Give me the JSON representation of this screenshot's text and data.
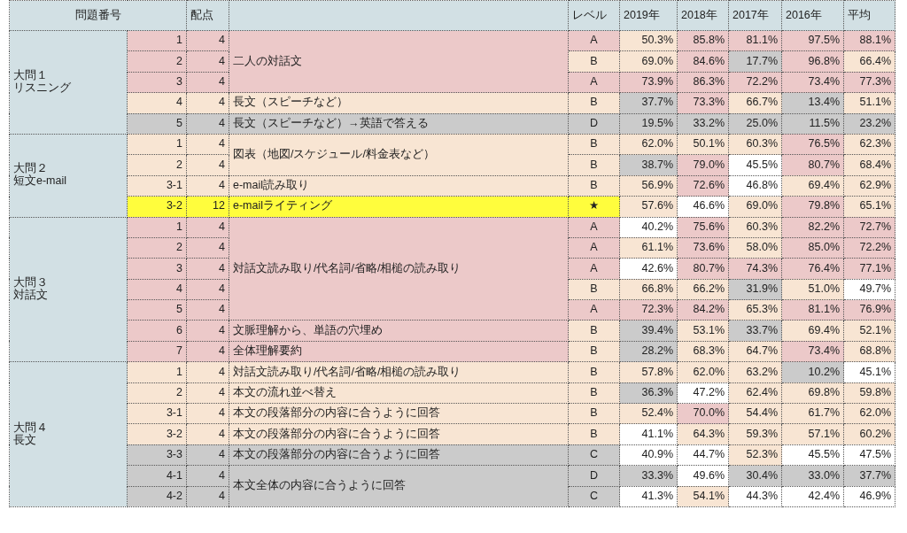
{
  "header": {
    "question_number": "問題番号",
    "points": "配点",
    "level": "レベル",
    "years": [
      "2019年",
      "2018年",
      "2017年",
      "2016年"
    ],
    "average": "平均"
  },
  "sections": [
    {
      "title": "大問１",
      "subtitle": "リスニング",
      "groups": [
        {
          "description": "二人の対話文",
          "color": "#ecc9c9",
          "rows": [
            {
              "no": "1",
              "points": "4",
              "level": {
                "text": "A",
                "color": "#ecc9c9"
              },
              "values": [
                {
                  "text": "50.3%",
                  "color": "#f8e5d3"
                },
                {
                  "text": "85.8%",
                  "color": "#ecc9c9"
                },
                {
                  "text": "81.1%",
                  "color": "#ecc9c9"
                },
                {
                  "text": "97.5%",
                  "color": "#ecc9c9"
                },
                {
                  "text": "88.1%",
                  "color": "#ecc9c9"
                }
              ]
            },
            {
              "no": "2",
              "points": "4",
              "level": {
                "text": "B",
                "color": "#f8e5d3"
              },
              "values": [
                {
                  "text": "69.0%",
                  "color": "#f8e5d3"
                },
                {
                  "text": "84.6%",
                  "color": "#ecc9c9"
                },
                {
                  "text": "17.7%",
                  "color": "#cbcbcb"
                },
                {
                  "text": "96.8%",
                  "color": "#ecc9c9"
                },
                {
                  "text": "66.4%",
                  "color": "#f8e5d3"
                }
              ]
            },
            {
              "no": "3",
              "points": "4",
              "level": {
                "text": "A",
                "color": "#ecc9c9"
              },
              "values": [
                {
                  "text": "73.9%",
                  "color": "#ecc9c9"
                },
                {
                  "text": "86.3%",
                  "color": "#ecc9c9"
                },
                {
                  "text": "72.2%",
                  "color": "#ecc9c9"
                },
                {
                  "text": "73.4%",
                  "color": "#ecc9c9"
                },
                {
                  "text": "77.3%",
                  "color": "#ecc9c9"
                }
              ]
            }
          ]
        },
        {
          "description": "長文（スピーチなど）",
          "color": "#f8e5d3",
          "rows": [
            {
              "no": "4",
              "points": "4",
              "level": {
                "text": "B",
                "color": "#f8e5d3"
              },
              "values": [
                {
                  "text": "37.7%",
                  "color": "#cbcbcb"
                },
                {
                  "text": "73.3%",
                  "color": "#ecc9c9"
                },
                {
                  "text": "66.7%",
                  "color": "#f8e5d3"
                },
                {
                  "text": "13.4%",
                  "color": "#cbcbcb"
                },
                {
                  "text": "51.1%",
                  "color": "#f8e5d3"
                }
              ]
            }
          ]
        },
        {
          "description": "長文（スピーチなど）→英語で答える",
          "color": "#cbcbcb",
          "rows": [
            {
              "no": "5",
              "points": "4",
              "level": {
                "text": "D",
                "color": "#cbcbcb"
              },
              "values": [
                {
                  "text": "19.5%",
                  "color": "#cbcbcb"
                },
                {
                  "text": "33.2%",
                  "color": "#cbcbcb"
                },
                {
                  "text": "25.0%",
                  "color": "#cbcbcb"
                },
                {
                  "text": "11.5%",
                  "color": "#cbcbcb"
                },
                {
                  "text": "23.2%",
                  "color": "#cbcbcb"
                }
              ]
            }
          ]
        }
      ]
    },
    {
      "title": "大問２",
      "subtitle": "短文e-mail",
      "groups": [
        {
          "description": "図表（地図/スケジュール/料金表など）",
          "color": "#f8e5d3",
          "rows": [
            {
              "no": "1",
              "points": "4",
              "level": {
                "text": "B",
                "color": "#f8e5d3"
              },
              "values": [
                {
                  "text": "62.0%",
                  "color": "#f8e5d3"
                },
                {
                  "text": "50.1%",
                  "color": "#f8e5d3"
                },
                {
                  "text": "60.3%",
                  "color": "#f8e5d3"
                },
                {
                  "text": "76.5%",
                  "color": "#ecc9c9"
                },
                {
                  "text": "62.3%",
                  "color": "#f8e5d3"
                }
              ]
            },
            {
              "no": "2",
              "points": "4",
              "level": {
                "text": "B",
                "color": "#f8e5d3"
              },
              "values": [
                {
                  "text": "38.7%",
                  "color": "#cbcbcb"
                },
                {
                  "text": "79.0%",
                  "color": "#ecc9c9"
                },
                {
                  "text": "45.5%",
                  "color": "#ffffff"
                },
                {
                  "text": "80.7%",
                  "color": "#ecc9c9"
                },
                {
                  "text": "68.4%",
                  "color": "#f8e5d3"
                }
              ]
            }
          ]
        },
        {
          "description": "e-mail読み取り",
          "color": "#f8e5d3",
          "rows": [
            {
              "no": "3-1",
              "points": "4",
              "level": {
                "text": "B",
                "color": "#f8e5d3"
              },
              "values": [
                {
                  "text": "56.9%",
                  "color": "#f8e5d3"
                },
                {
                  "text": "72.6%",
                  "color": "#ecc9c9"
                },
                {
                  "text": "46.8%",
                  "color": "#ffffff"
                },
                {
                  "text": "69.4%",
                  "color": "#f8e5d3"
                },
                {
                  "text": "62.9%",
                  "color": "#f8e5d3"
                }
              ]
            }
          ]
        },
        {
          "description": "e-mailライティング",
          "color": "#fffd3d",
          "rows": [
            {
              "no": "3-2",
              "points": "12",
              "level": {
                "text": "★",
                "color": "#fffd3d"
              },
              "values": [
                {
                  "text": "57.6%",
                  "color": "#f8e5d3"
                },
                {
                  "text": "46.6%",
                  "color": "#ffffff"
                },
                {
                  "text": "69.0%",
                  "color": "#f8e5d3"
                },
                {
                  "text": "79.8%",
                  "color": "#ecc9c9"
                },
                {
                  "text": "65.1%",
                  "color": "#f8e5d3"
                }
              ]
            }
          ]
        }
      ]
    },
    {
      "title": "大問３",
      "subtitle": "対話文",
      "groups": [
        {
          "description": "対話文読み取り/代名詞/省略/相槌の読み取り",
          "color": "#ecc9c9",
          "rows": [
            {
              "no": "1",
              "points": "4",
              "level": {
                "text": "A",
                "color": "#ecc9c9"
              },
              "values": [
                {
                  "text": "40.2%",
                  "color": "#ffffff"
                },
                {
                  "text": "75.6%",
                  "color": "#ecc9c9"
                },
                {
                  "text": "60.3%",
                  "color": "#f8e5d3"
                },
                {
                  "text": "82.2%",
                  "color": "#ecc9c9"
                },
                {
                  "text": "72.7%",
                  "color": "#ecc9c9"
                }
              ]
            },
            {
              "no": "2",
              "points": "4",
              "level": {
                "text": "A",
                "color": "#ecc9c9"
              },
              "values": [
                {
                  "text": "61.1%",
                  "color": "#f8e5d3"
                },
                {
                  "text": "73.6%",
                  "color": "#ecc9c9"
                },
                {
                  "text": "58.0%",
                  "color": "#f8e5d3"
                },
                {
                  "text": "85.0%",
                  "color": "#ecc9c9"
                },
                {
                  "text": "72.2%",
                  "color": "#ecc9c9"
                }
              ]
            },
            {
              "no": "3",
              "points": "4",
              "level": {
                "text": "A",
                "color": "#ecc9c9"
              },
              "values": [
                {
                  "text": "42.6%",
                  "color": "#ffffff"
                },
                {
                  "text": "80.7%",
                  "color": "#ecc9c9"
                },
                {
                  "text": "74.3%",
                  "color": "#ecc9c9"
                },
                {
                  "text": "76.4%",
                  "color": "#ecc9c9"
                },
                {
                  "text": "77.1%",
                  "color": "#ecc9c9"
                }
              ]
            },
            {
              "no": "4",
              "points": "4",
              "level": {
                "text": "B",
                "color": "#f8e5d3"
              },
              "values": [
                {
                  "text": "66.8%",
                  "color": "#f8e5d3"
                },
                {
                  "text": "66.2%",
                  "color": "#f8e5d3"
                },
                {
                  "text": "31.9%",
                  "color": "#cbcbcb"
                },
                {
                  "text": "51.0%",
                  "color": "#f8e5d3"
                },
                {
                  "text": "49.7%",
                  "color": "#ffffff"
                }
              ]
            },
            {
              "no": "5",
              "points": "4",
              "level": {
                "text": "A",
                "color": "#ecc9c9"
              },
              "values": [
                {
                  "text": "72.3%",
                  "color": "#ecc9c9"
                },
                {
                  "text": "84.2%",
                  "color": "#ecc9c9"
                },
                {
                  "text": "65.3%",
                  "color": "#f8e5d3"
                },
                {
                  "text": "81.1%",
                  "color": "#ecc9c9"
                },
                {
                  "text": "76.9%",
                  "color": "#ecc9c9"
                }
              ]
            }
          ]
        },
        {
          "description": "文脈理解から、単語の穴埋め",
          "color": "#ecc9c9",
          "rows": [
            {
              "no": "6",
              "points": "4",
              "level": {
                "text": "B",
                "color": "#f8e5d3"
              },
              "values": [
                {
                  "text": "39.4%",
                  "color": "#cbcbcb"
                },
                {
                  "text": "53.1%",
                  "color": "#f8e5d3"
                },
                {
                  "text": "33.7%",
                  "color": "#cbcbcb"
                },
                {
                  "text": "69.4%",
                  "color": "#f8e5d3"
                },
                {
                  "text": "52.1%",
                  "color": "#f8e5d3"
                }
              ]
            }
          ]
        },
        {
          "description": "全体理解要約",
          "color": "#ecc9c9",
          "rows": [
            {
              "no": "7",
              "points": "4",
              "level": {
                "text": "B",
                "color": "#f8e5d3"
              },
              "values": [
                {
                  "text": "28.2%",
                  "color": "#cbcbcb"
                },
                {
                  "text": "68.3%",
                  "color": "#f8e5d3"
                },
                {
                  "text": "64.7%",
                  "color": "#f8e5d3"
                },
                {
                  "text": "73.4%",
                  "color": "#ecc9c9"
                },
                {
                  "text": "68.8%",
                  "color": "#f8e5d3"
                }
              ]
            }
          ]
        }
      ]
    },
    {
      "title": "大問４",
      "subtitle": "長文",
      "groups": [
        {
          "description": "対話文読み取り/代名詞/省略/相槌の読み取り",
          "color": "#f8e5d3",
          "rows": [
            {
              "no": "1",
              "points": "4",
              "level": {
                "text": "B",
                "color": "#f8e5d3"
              },
              "values": [
                {
                  "text": "57.8%",
                  "color": "#f8e5d3"
                },
                {
                  "text": "62.0%",
                  "color": "#f8e5d3"
                },
                {
                  "text": "63.2%",
                  "color": "#f8e5d3"
                },
                {
                  "text": "10.2%",
                  "color": "#cbcbcb"
                },
                {
                  "text": "45.1%",
                  "color": "#ffffff"
                }
              ]
            }
          ]
        },
        {
          "description": "本文の流れ並べ替え",
          "color": "#f8e5d3",
          "rows": [
            {
              "no": "2",
              "points": "4",
              "level": {
                "text": "B",
                "color": "#f8e5d3"
              },
              "values": [
                {
                  "text": "36.3%",
                  "color": "#cbcbcb"
                },
                {
                  "text": "47.2%",
                  "color": "#ffffff"
                },
                {
                  "text": "62.4%",
                  "color": "#f8e5d3"
                },
                {
                  "text": "69.8%",
                  "color": "#f8e5d3"
                },
                {
                  "text": "59.8%",
                  "color": "#f8e5d3"
                }
              ]
            }
          ]
        },
        {
          "description": "本文の段落部分の内容に合うように回答",
          "color": "#f8e5d3",
          "rows": [
            {
              "no": "3-1",
              "points": "4",
              "level": {
                "text": "B",
                "color": "#f8e5d3"
              },
              "values": [
                {
                  "text": "52.4%",
                  "color": "#f8e5d3"
                },
                {
                  "text": "70.0%",
                  "color": "#ecc9c9"
                },
                {
                  "text": "54.4%",
                  "color": "#f8e5d3"
                },
                {
                  "text": "61.7%",
                  "color": "#f8e5d3"
                },
                {
                  "text": "62.0%",
                  "color": "#f8e5d3"
                }
              ]
            }
          ]
        },
        {
          "description": "本文の段落部分の内容に合うように回答",
          "color": "#f8e5d3",
          "rows": [
            {
              "no": "3-2",
              "points": "4",
              "level": {
                "text": "B",
                "color": "#f8e5d3"
              },
              "values": [
                {
                  "text": "41.1%",
                  "color": "#ffffff"
                },
                {
                  "text": "64.3%",
                  "color": "#f8e5d3"
                },
                {
                  "text": "59.3%",
                  "color": "#f8e5d3"
                },
                {
                  "text": "57.1%",
                  "color": "#f8e5d3"
                },
                {
                  "text": "60.2%",
                  "color": "#f8e5d3"
                }
              ]
            }
          ]
        },
        {
          "description": "本文の段落部分の内容に合うように回答",
          "color": "#cbcbcb",
          "rows": [
            {
              "no": "3-3",
              "points": "4",
              "level": {
                "text": "C",
                "color": "#cbcbcb"
              },
              "values": [
                {
                  "text": "40.9%",
                  "color": "#ffffff"
                },
                {
                  "text": "44.7%",
                  "color": "#ffffff"
                },
                {
                  "text": "52.3%",
                  "color": "#f8e5d3"
                },
                {
                  "text": "45.5%",
                  "color": "#ffffff"
                },
                {
                  "text": "47.5%",
                  "color": "#ffffff"
                }
              ]
            }
          ]
        },
        {
          "description": "本文全体の内容に合うように回答",
          "color": "#cbcbcb",
          "rows": [
            {
              "no": "4-1",
              "points": "4",
              "level": {
                "text": "D",
                "color": "#cbcbcb"
              },
              "values": [
                {
                  "text": "33.3%",
                  "color": "#cbcbcb"
                },
                {
                  "text": "49.6%",
                  "color": "#ffffff"
                },
                {
                  "text": "30.4%",
                  "color": "#cbcbcb"
                },
                {
                  "text": "33.0%",
                  "color": "#cbcbcb"
                },
                {
                  "text": "37.7%",
                  "color": "#cbcbcb"
                }
              ]
            },
            {
              "no": "4-2",
              "points": "4",
              "level": {
                "text": "C",
                "color": "#cbcbcb"
              },
              "values": [
                {
                  "text": "41.3%",
                  "color": "#ffffff"
                },
                {
                  "text": "54.1%",
                  "color": "#f8e5d3"
                },
                {
                  "text": "44.3%",
                  "color": "#ffffff"
                },
                {
                  "text": "42.4%",
                  "color": "#ffffff"
                },
                {
                  "text": "46.9%",
                  "color": "#ffffff"
                }
              ]
            }
          ]
        }
      ]
    }
  ]
}
